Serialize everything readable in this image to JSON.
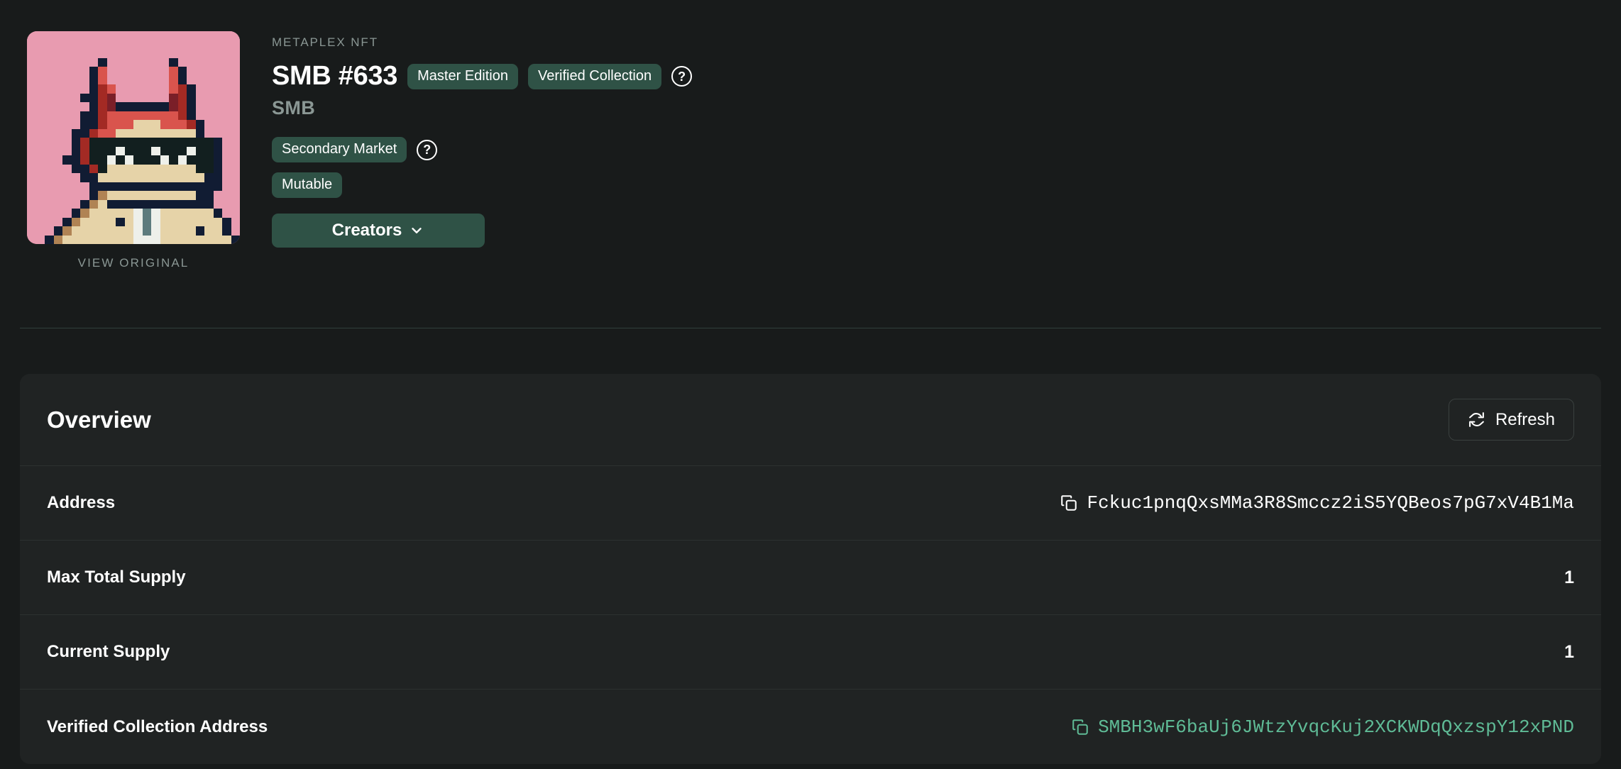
{
  "hero": {
    "eyebrow": "METAPLEX NFT",
    "title": "SMB #633",
    "subtitle": "SMB",
    "view_original": "VIEW ORIGINAL",
    "badges": [
      {
        "label": "Master Edition"
      },
      {
        "label": "Verified Collection"
      }
    ],
    "help_glyph": "?",
    "secondary_market_badge": "Secondary Market",
    "mutable_badge": "Mutable",
    "creators_button": "Creators",
    "chevron_glyph": "⌄"
  },
  "overview": {
    "title": "Overview",
    "refresh_label": "Refresh",
    "rows": [
      {
        "label": "Address",
        "value": "Fckuc1pnqQxsMMa3R8Smccz2iS5YQBeos7pG7xV4B1Ma",
        "has_copy": true,
        "is_link": false,
        "mono": true
      },
      {
        "label": "Max Total Supply",
        "value": "1",
        "has_copy": false,
        "is_link": false,
        "mono": false
      },
      {
        "label": "Current Supply",
        "value": "1",
        "has_copy": false,
        "is_link": false,
        "mono": false
      },
      {
        "label": "Verified Collection Address",
        "value": "SMBH3wF6baUj6JWtzYvqcKuj2XCKWDqQxzspY12xPND",
        "has_copy": true,
        "is_link": true,
        "mono": true
      }
    ]
  },
  "colors": {
    "page_bg": "#181b1b",
    "card_bg": "#202323",
    "badge_green": "#2f5246",
    "link_green": "#5fbb96",
    "muted_text": "#8a9794",
    "divider": "#2c3130"
  },
  "artwork": {
    "name": "smb-pixel-avatar",
    "background": "#e89bb0",
    "palette": {
      "k": "#111c33",
      "r": "#d9544d",
      "d": "#a32a24",
      "m": "#7a1f28",
      "t": "#121f1f",
      "s": "#cba77a",
      "b": "#e6d3a8",
      "w": "#eef0ea",
      "g": "#5d7b7d",
      "p": "#e89bb0",
      "n": "#b08354",
      "x": "#233140"
    },
    "rows": [
      "pppppppppppppppppppppppp",
      "pppppppppppppppppppppppp",
      "pppppppppppppppppppppppp",
      "ppppppppkpppppppkppppppp",
      "pppppppkrppppppprkpppppp",
      "pppppppkrppppppprkpppppp",
      "pppppppkdrpppppprdkppppp",
      "ppppppkkdmppppppmdkppppp",
      "pppppppkdmkkkkkkmdkppppp",
      "ppppppkkdrrrrrrrrdkppppp",
      "ppppppkkdrrrbbbrrrdkpppp",
      "pppppkkdrrbbbbbbbbbkpppp",
      "pppppkdttttttttttttttkpp",
      "pppppkdtttwtttwtttwttkpp",
      "ppppkkdttwtwtttwtwtttkpp",
      "pppppkkdtbbbbbbbbbbttkpp",
      "ppppppkkbbbbbbbbbbbbkkpp",
      "pppppppkkkkkkkkkkkkkkkpp",
      "pppppppknbbbbbbbbbbkkppp",
      "ppppppknbkkkkkkkkkkkkppp",
      "pppppknbbbbbwgwbbbbbbkpp",
      "ppppknbbbbkbwgwbbbbbbbkp",
      "pppknbbbbbbbwgwbbbbkbbkp",
      "ppknbbbbbbbbwwwbbbbbbbbk"
    ]
  }
}
